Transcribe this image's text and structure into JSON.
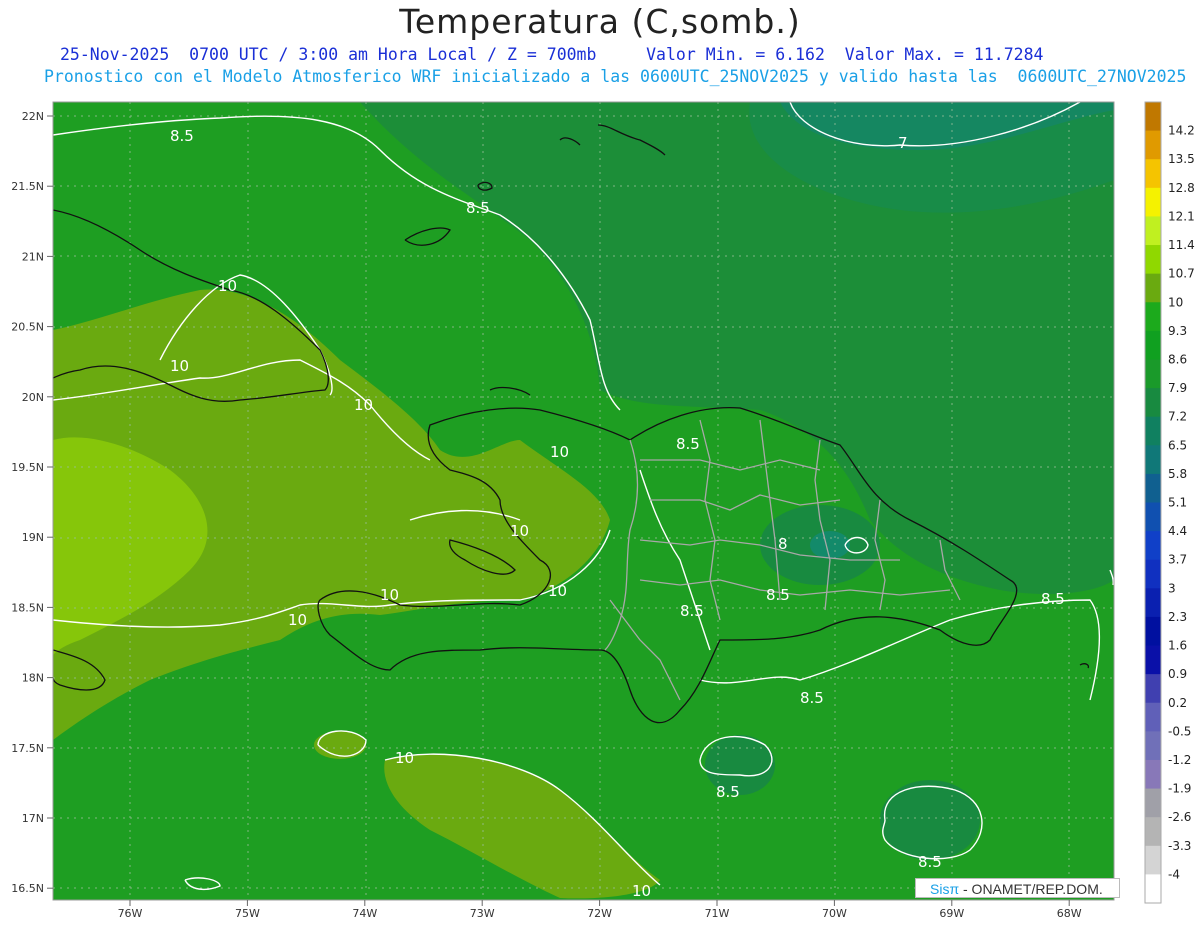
{
  "header": {
    "title": "Temperatura (C,somb.)",
    "line1": "25-Nov-2025  0700 UTC / 3:00 am Hora Local / Z = 700mb     Valor Min. = 6.162  Valor Max. = 11.7284",
    "line2": "Pronostico con el Modelo Atmosferico WRF inicializado a las 0600UTC_25NOV2025 y valido hasta las  0600UTC_27NOV2025"
  },
  "axes": {
    "lat_labels": [
      "22N",
      "21.5N",
      "21N",
      "20.5N",
      "20N",
      "19.5N",
      "19N",
      "18.5N",
      "18N",
      "17.5N",
      "17N",
      "16.5N"
    ],
    "lon_labels": [
      "76W",
      "75W",
      "74W",
      "73W",
      "72W",
      "71W",
      "70W",
      "69W",
      "68W"
    ]
  },
  "colorbar": {
    "labels": [
      "14.2",
      "13.5",
      "12.8",
      "12.1",
      "11.4",
      "10.7",
      "10",
      "9.3",
      "8.6",
      "7.9",
      "7.2",
      "6.5",
      "5.8",
      "5.1",
      "4.4",
      "3.7",
      "3",
      "2.3",
      "1.6",
      "0.9",
      "0.2",
      "-0.5",
      "-1.2",
      "-1.9",
      "-2.6",
      "-3.3",
      "-4"
    ],
    "colors": [
      "#c07800",
      "#e09a00",
      "#f5c400",
      "#f5f200",
      "#c0f020",
      "#90d800",
      "#6aaa10",
      "#1caa1c",
      "#10a020",
      "#1a9a2a",
      "#188a40",
      "#108060",
      "#107878",
      "#106090",
      "#1050b0",
      "#1040c8",
      "#1030c0",
      "#0a20b0",
      "#0010a0",
      "#0a10a8",
      "#4040b0",
      "#6060b8",
      "#7070b8",
      "#8878b8",
      "#a0a0a8",
      "#b4b4b4",
      "#d4d4d4",
      "#ffffff"
    ]
  },
  "contour_labels": [
    {
      "text": "8.5"
    },
    {
      "text": "7"
    },
    {
      "text": "8.5"
    },
    {
      "text": "10"
    },
    {
      "text": "10"
    },
    {
      "text": "10"
    },
    {
      "text": "10"
    },
    {
      "text": "10"
    },
    {
      "text": "10"
    },
    {
      "text": "10"
    },
    {
      "text": "10"
    },
    {
      "text": "8.5"
    },
    {
      "text": "8"
    },
    {
      "text": "8.5"
    },
    {
      "text": "8.5"
    },
    {
      "text": "8.5"
    },
    {
      "text": "8.5"
    },
    {
      "text": "10"
    },
    {
      "text": "8.5"
    },
    {
      "text": "8.5"
    },
    {
      "text": "10"
    },
    {
      "text": "10"
    }
  ],
  "credit": {
    "logo": "Sisπ",
    "org": " - ONAMET/REP.DOM."
  }
}
